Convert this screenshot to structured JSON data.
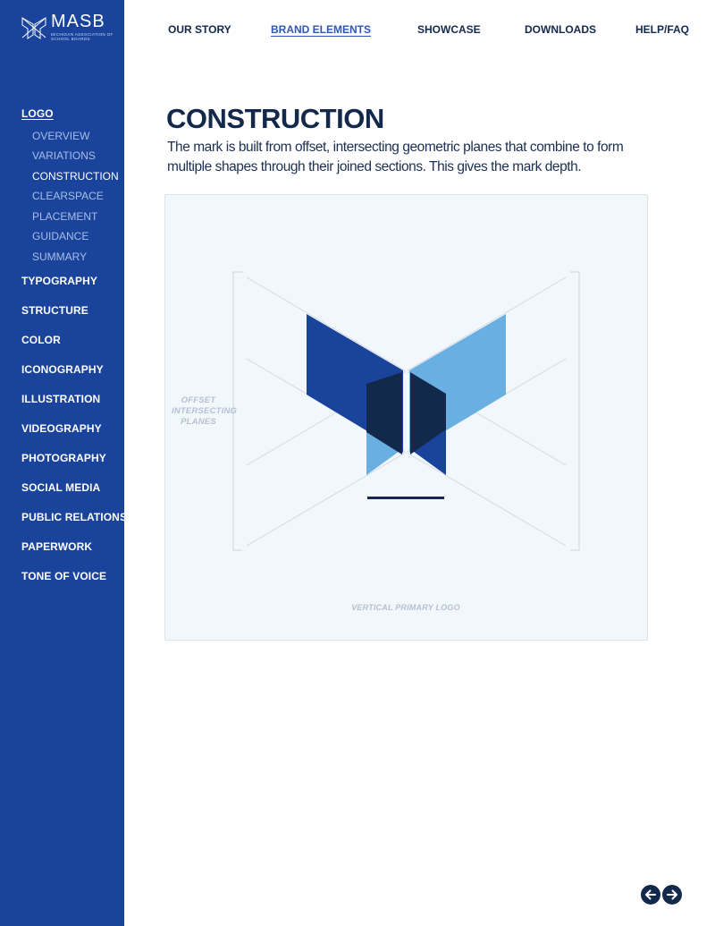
{
  "brand": {
    "wordmark": "MASB",
    "tagline": "Michigan Association of School Boards"
  },
  "topnav": [
    {
      "label": "OUR STORY"
    },
    {
      "label": "BRAND ELEMENTS"
    },
    {
      "label": "SHOWCASE"
    },
    {
      "label": "DOWNLOADS"
    },
    {
      "label": "HELP/FAQ"
    }
  ],
  "sidebar": {
    "current_section": "LOGO",
    "sub_items": [
      "OVERVIEW",
      "VARIATIONS",
      "CONSTRUCTION",
      "CLEARSPACE",
      "PLACEMENT",
      "GUIDANCE",
      "SUMMARY"
    ],
    "sections": [
      "TYPOGRAPHY",
      "STRUCTURE",
      "COLOR",
      "ICONOGRAPHY",
      "ILLUSTRATION",
      "VIDEOGRAPHY",
      "PHOTOGRAPHY",
      "SOCIAL MEDIA",
      "PUBLIC RELATIONS",
      "PAPERWORK",
      "TONE OF VOICE"
    ]
  },
  "main": {
    "title": "CONSTRUCTION",
    "description": "The mark is built from offset, intersecting geometric planes that combine to form multiple shapes through their joined sections. This gives the mark depth.",
    "callout": "OFFSET INTERSECTING PLANES",
    "caption": "VERTICAL PRIMARY LOGO"
  },
  "pager": {
    "prev_icon": "arrow-left-icon",
    "next_icon": "arrow-right-icon"
  },
  "colors": {
    "sidebar": "#1a449c",
    "navy": "#13294b",
    "blue": "#1a449c",
    "light_blue": "#6aafe1",
    "panel": "#f2f7fb"
  }
}
